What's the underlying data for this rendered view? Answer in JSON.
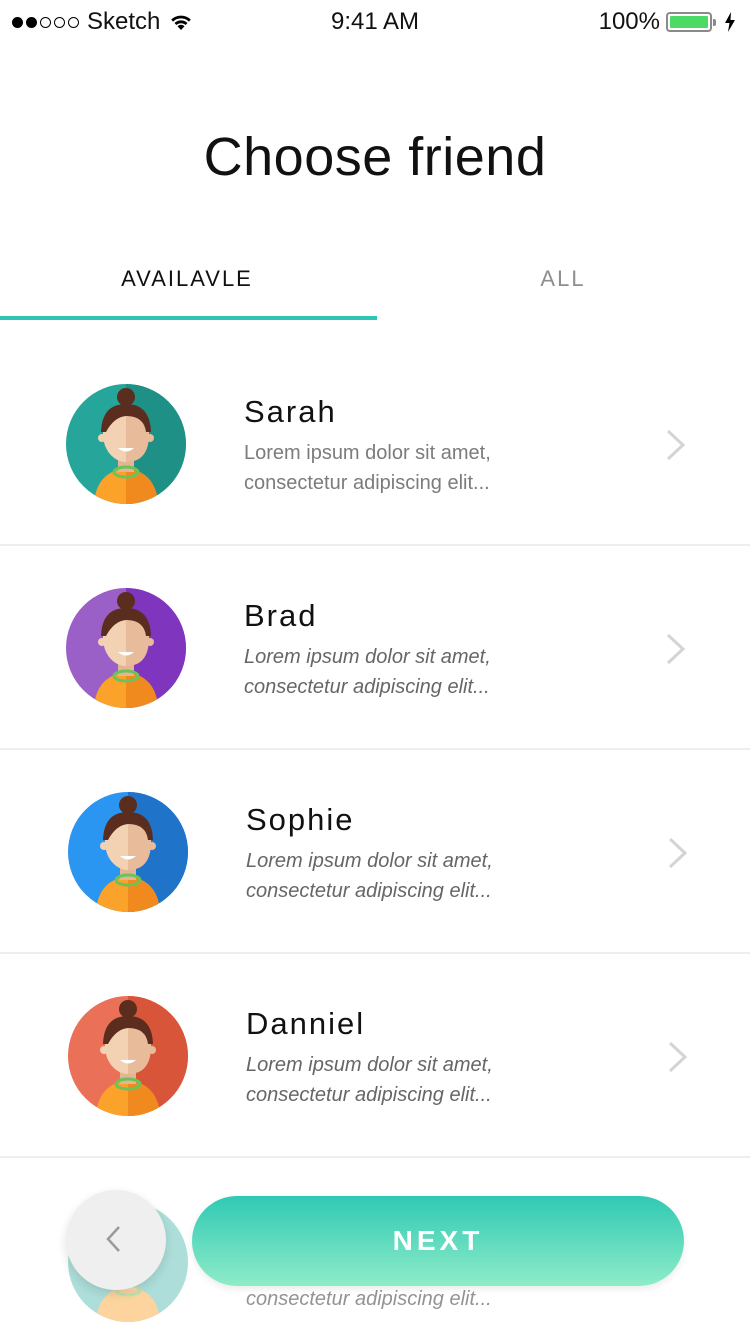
{
  "status_bar": {
    "carrier": "Sketch",
    "time": "9:41 AM",
    "battery": "100%"
  },
  "page": {
    "title": "Choose friend"
  },
  "tabs": [
    {
      "label": "AVAILAVLE",
      "active": true
    },
    {
      "label": "ALL",
      "active": false
    }
  ],
  "friends": [
    {
      "name": "Sarah",
      "desc_line1": "Lorem ipsum dolor sit amet,",
      "desc_line2": "consectetur adipiscing elit...",
      "avatar_color": "#26a69a"
    },
    {
      "name": "Brad",
      "desc_line1": "Lorem ipsum dolor sit amet,",
      "desc_line2": "consectetur adipiscing elit...",
      "avatar_color": "#8e44c7"
    },
    {
      "name": "Sophie",
      "desc_line1": "Lorem ipsum dolor sit amet,",
      "desc_line2": "consectetur adipiscing elit...",
      "avatar_color": "#2387e0"
    },
    {
      "name": "Danniel",
      "desc_line1": "Lorem ipsum dolor sit amet,",
      "desc_line2": "consectetur adipiscing elit...",
      "avatar_color": "#e06850"
    }
  ],
  "partial_row": {
    "desc_line2": "consectetur adipiscing elit..."
  },
  "actions": {
    "next_label": "NEXT",
    "back_icon": "chevron-left-icon"
  },
  "colors": {
    "accent": "#30c4b5"
  }
}
